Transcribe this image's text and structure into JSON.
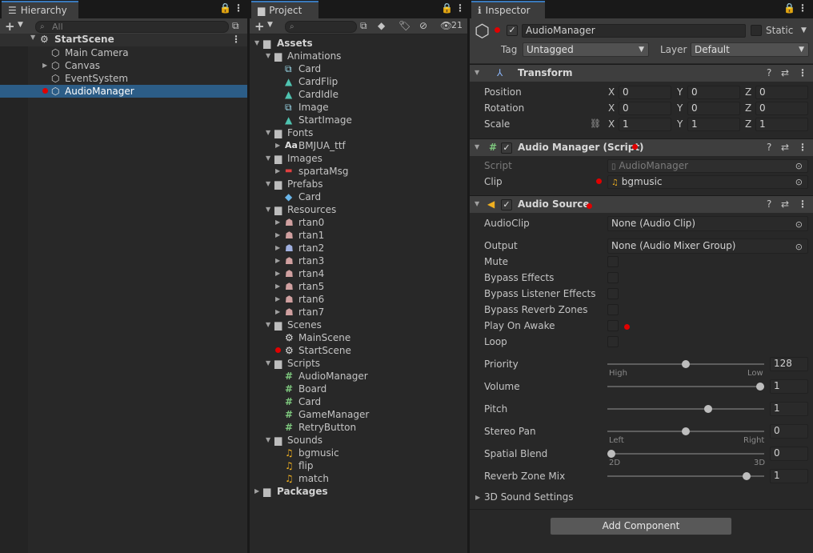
{
  "hierarchy": {
    "tab_label": "Hierarchy",
    "search_placeholder": "All",
    "scene_name": "StartScene",
    "items": [
      {
        "label": "Main Camera"
      },
      {
        "label": "Canvas"
      },
      {
        "label": "EventSystem"
      },
      {
        "label": "AudioManager"
      }
    ]
  },
  "project": {
    "tab_label": "Project",
    "hidden_count": "21",
    "root": "Assets",
    "tree": {
      "animations": {
        "label": "Animations",
        "items": [
          "Card",
          "CardFlip",
          "CardIdle",
          "Image",
          "StartImage"
        ]
      },
      "fonts": {
        "label": "Fonts",
        "items": [
          "BMJUA_ttf"
        ]
      },
      "images": {
        "label": "Images",
        "items": [
          "spartaMsg"
        ]
      },
      "prefabs": {
        "label": "Prefabs",
        "items": [
          "Card"
        ]
      },
      "resources": {
        "label": "Resources",
        "items": [
          "rtan0",
          "rtan1",
          "rtan2",
          "rtan3",
          "rtan4",
          "rtan5",
          "rtan6",
          "rtan7"
        ]
      },
      "scenes": {
        "label": "Scenes",
        "items": [
          "MainScene",
          "StartScene"
        ]
      },
      "scripts": {
        "label": "Scripts",
        "items": [
          "AudioManager",
          "Board",
          "Card",
          "GameManager",
          "RetryButton"
        ]
      },
      "sounds": {
        "label": "Sounds",
        "items": [
          "bgmusic",
          "flip",
          "match"
        ]
      }
    },
    "packages": "Packages"
  },
  "inspector": {
    "tab_label": "Inspector",
    "object_name": "AudioManager",
    "static_label": "Static",
    "tag_label": "Tag",
    "tag_value": "Untagged",
    "layer_label": "Layer",
    "layer_value": "Default",
    "transform": {
      "title": "Transform",
      "position_label": "Position",
      "rotation_label": "Rotation",
      "scale_label": "Scale",
      "position": {
        "x": "0",
        "y": "0",
        "z": "0"
      },
      "rotation": {
        "x": "0",
        "y": "0",
        "z": "0"
      },
      "scale": {
        "x": "1",
        "y": "1",
        "z": "1"
      }
    },
    "axis": {
      "x": "X",
      "y": "Y",
      "z": "Z"
    },
    "audio_manager": {
      "title": "Audio Manager (Script)",
      "script_label": "Script",
      "script_value": "AudioManager",
      "clip_label": "Clip",
      "clip_value": "bgmusic"
    },
    "audio_source": {
      "title": "Audio Source",
      "audioclip_label": "AudioClip",
      "audioclip_value": "None (Audio Clip)",
      "output_label": "Output",
      "output_value": "None (Audio Mixer Group)",
      "mute_label": "Mute",
      "bypass_effects_label": "Bypass Effects",
      "bypass_listener_label": "Bypass Listener Effects",
      "bypass_reverb_label": "Bypass Reverb Zones",
      "play_on_awake_label": "Play On Awake",
      "loop_label": "Loop",
      "priority_label": "Priority",
      "priority_value": "128",
      "priority_fraction": 0.5,
      "priority_high": "High",
      "priority_low": "Low",
      "volume_label": "Volume",
      "volume_value": "1",
      "volume_fraction": 1.0,
      "pitch_label": "Pitch",
      "pitch_value": "1",
      "pitch_fraction": 0.65,
      "stereo_label": "Stereo Pan",
      "stereo_value": "0",
      "stereo_fraction": 0.5,
      "stereo_left": "Left",
      "stereo_right": "Right",
      "spatial_label": "Spatial Blend",
      "spatial_value": "0",
      "spatial_fraction": 0.0,
      "spatial_2d": "2D",
      "spatial_3d": "3D",
      "reverb_label": "Reverb Zone Mix",
      "reverb_value": "1",
      "reverb_fraction": 0.91,
      "sound_settings_label": "3D Sound Settings"
    },
    "add_component_label": "Add Component"
  },
  "colors": {
    "selection": "#2c5d87",
    "marker": "#e00000",
    "tab_accent": "#3a79bb"
  }
}
